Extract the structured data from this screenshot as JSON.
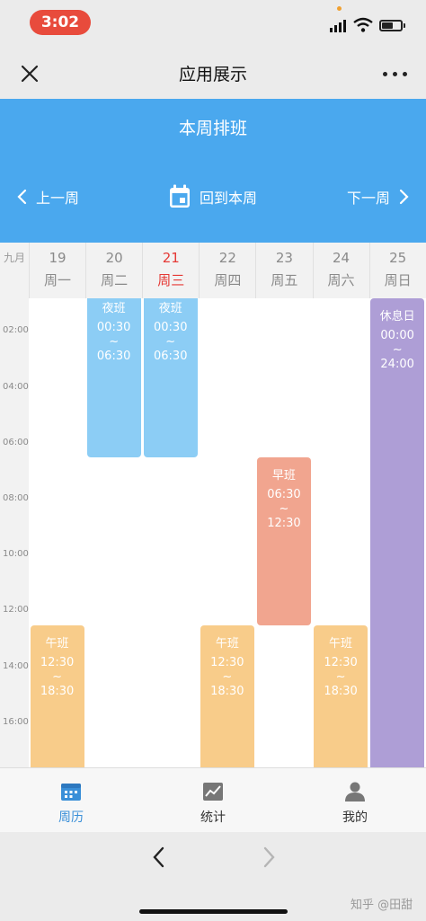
{
  "status_bar": {
    "time": "3:02"
  },
  "nav": {
    "title": "应用展示"
  },
  "header": {
    "title": "本周排班",
    "prev_label": "上一周",
    "current_label": "回到本周",
    "next_label": "下一周"
  },
  "calendar": {
    "month": "九月",
    "days": [
      {
        "num": "19",
        "name": "周一"
      },
      {
        "num": "20",
        "name": "周二"
      },
      {
        "num": "21",
        "name": "周三",
        "today": true
      },
      {
        "num": "22",
        "name": "周四"
      },
      {
        "num": "23",
        "name": "周五"
      },
      {
        "num": "24",
        "name": "周六"
      },
      {
        "num": "25",
        "name": "周日"
      }
    ],
    "time_labels": [
      "02:00",
      "04:00",
      "06:00",
      "08:00",
      "10:00",
      "12:00",
      "14:00",
      "16:00"
    ],
    "events": [
      {
        "day": 1,
        "name": "夜班",
        "start": "00:30",
        "sep": "~",
        "end": "06:30",
        "color": "#8ccdf5"
      },
      {
        "day": 2,
        "name": "夜班",
        "start": "00:30",
        "sep": "~",
        "end": "06:30",
        "color": "#8ccdf5"
      },
      {
        "day": 4,
        "name": "早班",
        "start": "06:30",
        "sep": "~",
        "end": "12:30",
        "color": "#f1a58f"
      },
      {
        "day": 0,
        "name": "午班",
        "start": "12:30",
        "sep": "~",
        "end": "18:30",
        "color": "#f8cc8a"
      },
      {
        "day": 3,
        "name": "午班",
        "start": "12:30",
        "sep": "~",
        "end": "18:30",
        "color": "#f8cc8a"
      },
      {
        "day": 5,
        "name": "午班",
        "start": "12:30",
        "sep": "~",
        "end": "18:30",
        "color": "#f8cc8a"
      },
      {
        "day": 6,
        "name": "休息日",
        "start": "00:00",
        "sep": "~",
        "end": "24:00",
        "color": "#ae9ed6"
      }
    ]
  },
  "tabs": [
    {
      "label": "周历",
      "icon": "calendar-icon",
      "active": true
    },
    {
      "label": "统计",
      "icon": "chart-icon"
    },
    {
      "label": "我的",
      "icon": "user-icon"
    }
  ],
  "watermark": "知乎 @田甜",
  "colors": {
    "accent": "#4aa8ee",
    "today": "#e53935",
    "tab_active": "#3a8fd8"
  }
}
